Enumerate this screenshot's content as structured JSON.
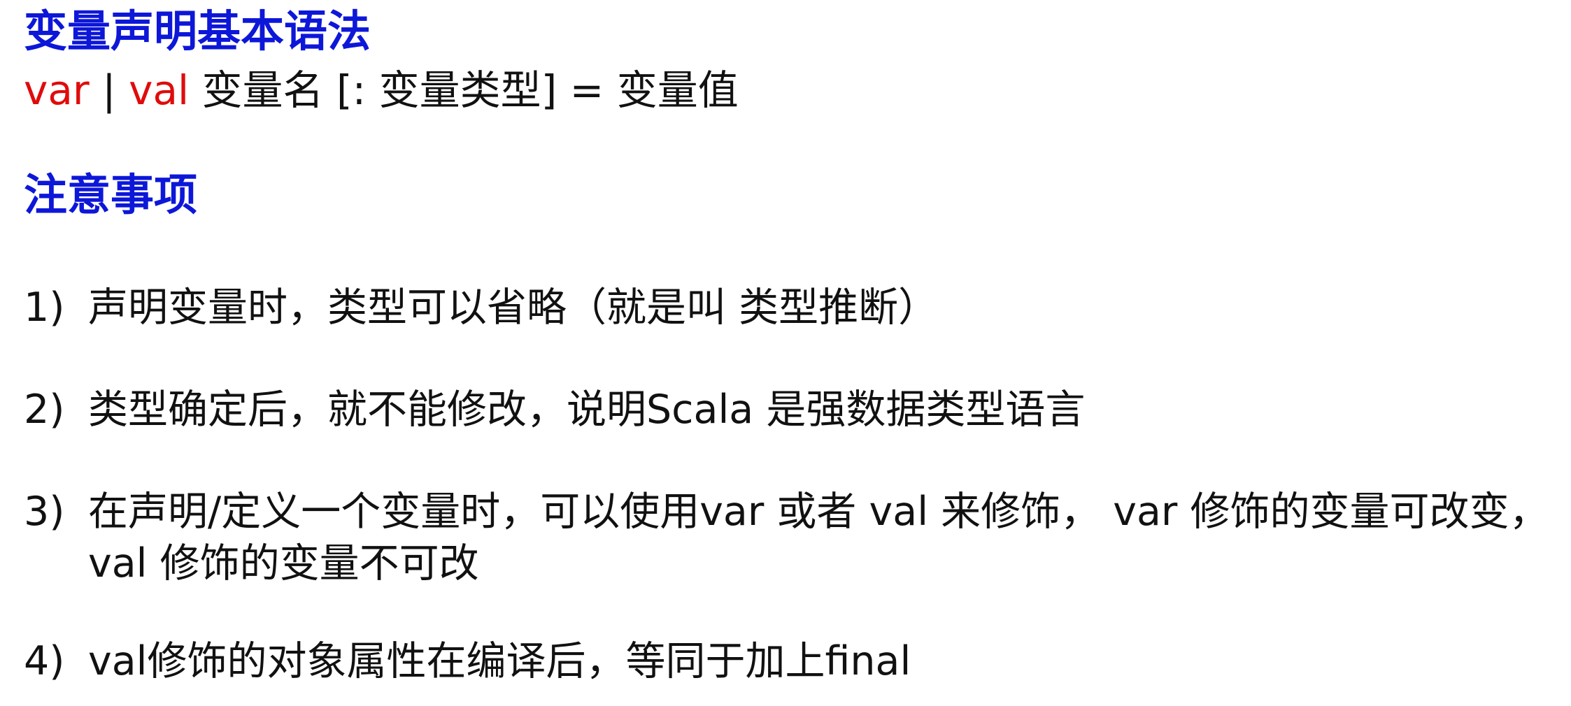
{
  "colors": {
    "heading": "#0d17d8",
    "keyword": "#e00b0b",
    "text": "#111111"
  },
  "syntax_section": {
    "title": "变量声明基本语法",
    "kw_var": "var",
    "sep": " | ",
    "kw_val": "val",
    "rest": " 变量名 [: 变量类型] = 变量值"
  },
  "notes_section": {
    "title": "注意事项",
    "items": [
      {
        "num": "1)",
        "text": "声明变量时，类型可以省略（就是叫 类型推断）"
      },
      {
        "num": "2)",
        "text": "类型确定后，就不能修改，说明Scala 是强数据类型语言"
      },
      {
        "num": "3)",
        "text": "在声明/定义一个变量时，可以使用var 或者 val 来修饰， var 修饰的变量可改变，val 修饰的变量不可改"
      },
      {
        "num": "4)",
        "text": "val修饰的对象属性在编译后，等同于加上final"
      }
    ]
  }
}
